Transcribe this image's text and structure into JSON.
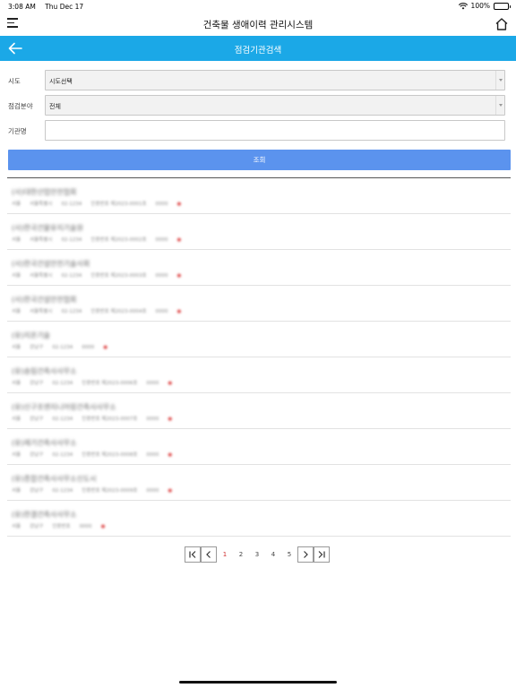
{
  "status_bar": {
    "time": "3:08 AM",
    "date": "Thu Dec 17",
    "battery": "100%"
  },
  "header": {
    "title": "건축물 생애이력 관리시스템",
    "menu_icon": "hamburger-icon",
    "home_icon": "home-icon"
  },
  "sub_header": {
    "title": "점검기관검색",
    "back_icon": "back-arrow-icon",
    "color": "#1ba8e7"
  },
  "form": {
    "sido": {
      "label": "시도",
      "value": "시도선택"
    },
    "field": {
      "label": "점검분야",
      "value": "전체"
    },
    "agency": {
      "label": "기관명",
      "value": ""
    }
  },
  "search_button": {
    "label": "조회",
    "color": "#5b93ee"
  },
  "results": [
    {
      "name": "(사)대한산업안전협회",
      "meta": [
        "서울",
        "서울특별시",
        "02-1234",
        "인증번호 제2023-0001호",
        "0000"
      ]
    },
    {
      "name": "(사)한국건물유지기술원",
      "meta": [
        "서울",
        "서울특별시",
        "02-1234",
        "인증번호 제2023-0002호",
        "0000"
      ]
    },
    {
      "name": "(사)한국건설안전기술사회",
      "meta": [
        "서울",
        "서울특별시",
        "02-1234",
        "인증번호 제2023-0003호",
        "0000"
      ]
    },
    {
      "name": "(사)한국건설안전협회",
      "meta": [
        "서울",
        "서울특별시",
        "02-1234",
        "인증번호 제2023-0004호",
        "0000"
      ]
    },
    {
      "name": "(유)지온기술",
      "meta": [
        "서울",
        "강남구",
        "02-1234",
        "0000"
      ]
    },
    {
      "name": "(유)송림건축사사무소",
      "meta": [
        "서울",
        "강남구",
        "02-1234",
        "인증번호 제2023-0006호",
        "0000"
      ]
    },
    {
      "name": "(유)신구조엔지니어링건축사사무소",
      "meta": [
        "서울",
        "강남구",
        "02-1234",
        "인증번호 제2023-0007호",
        "0000"
      ]
    },
    {
      "name": "(유)제기건축사사무소",
      "meta": [
        "서울",
        "강남구",
        "02-1234",
        "인증번호 제2023-0008호",
        "0000"
      ]
    },
    {
      "name": "(유)종합건축사사무소신도시",
      "meta": [
        "서울",
        "강남구",
        "02-1234",
        "인증번호 제2023-0009호",
        "0000"
      ]
    },
    {
      "name": "(유)한결건축사사무소",
      "meta": [
        "서울",
        "강남구",
        "인증번호",
        "0000"
      ]
    }
  ],
  "pagination": {
    "first_icon": "first-page-icon",
    "prev_icon": "prev-page-icon",
    "next_icon": "next-page-icon",
    "last_icon": "last-page-icon",
    "pages": [
      "1",
      "2",
      "3",
      "4",
      "5"
    ],
    "current": "1"
  }
}
